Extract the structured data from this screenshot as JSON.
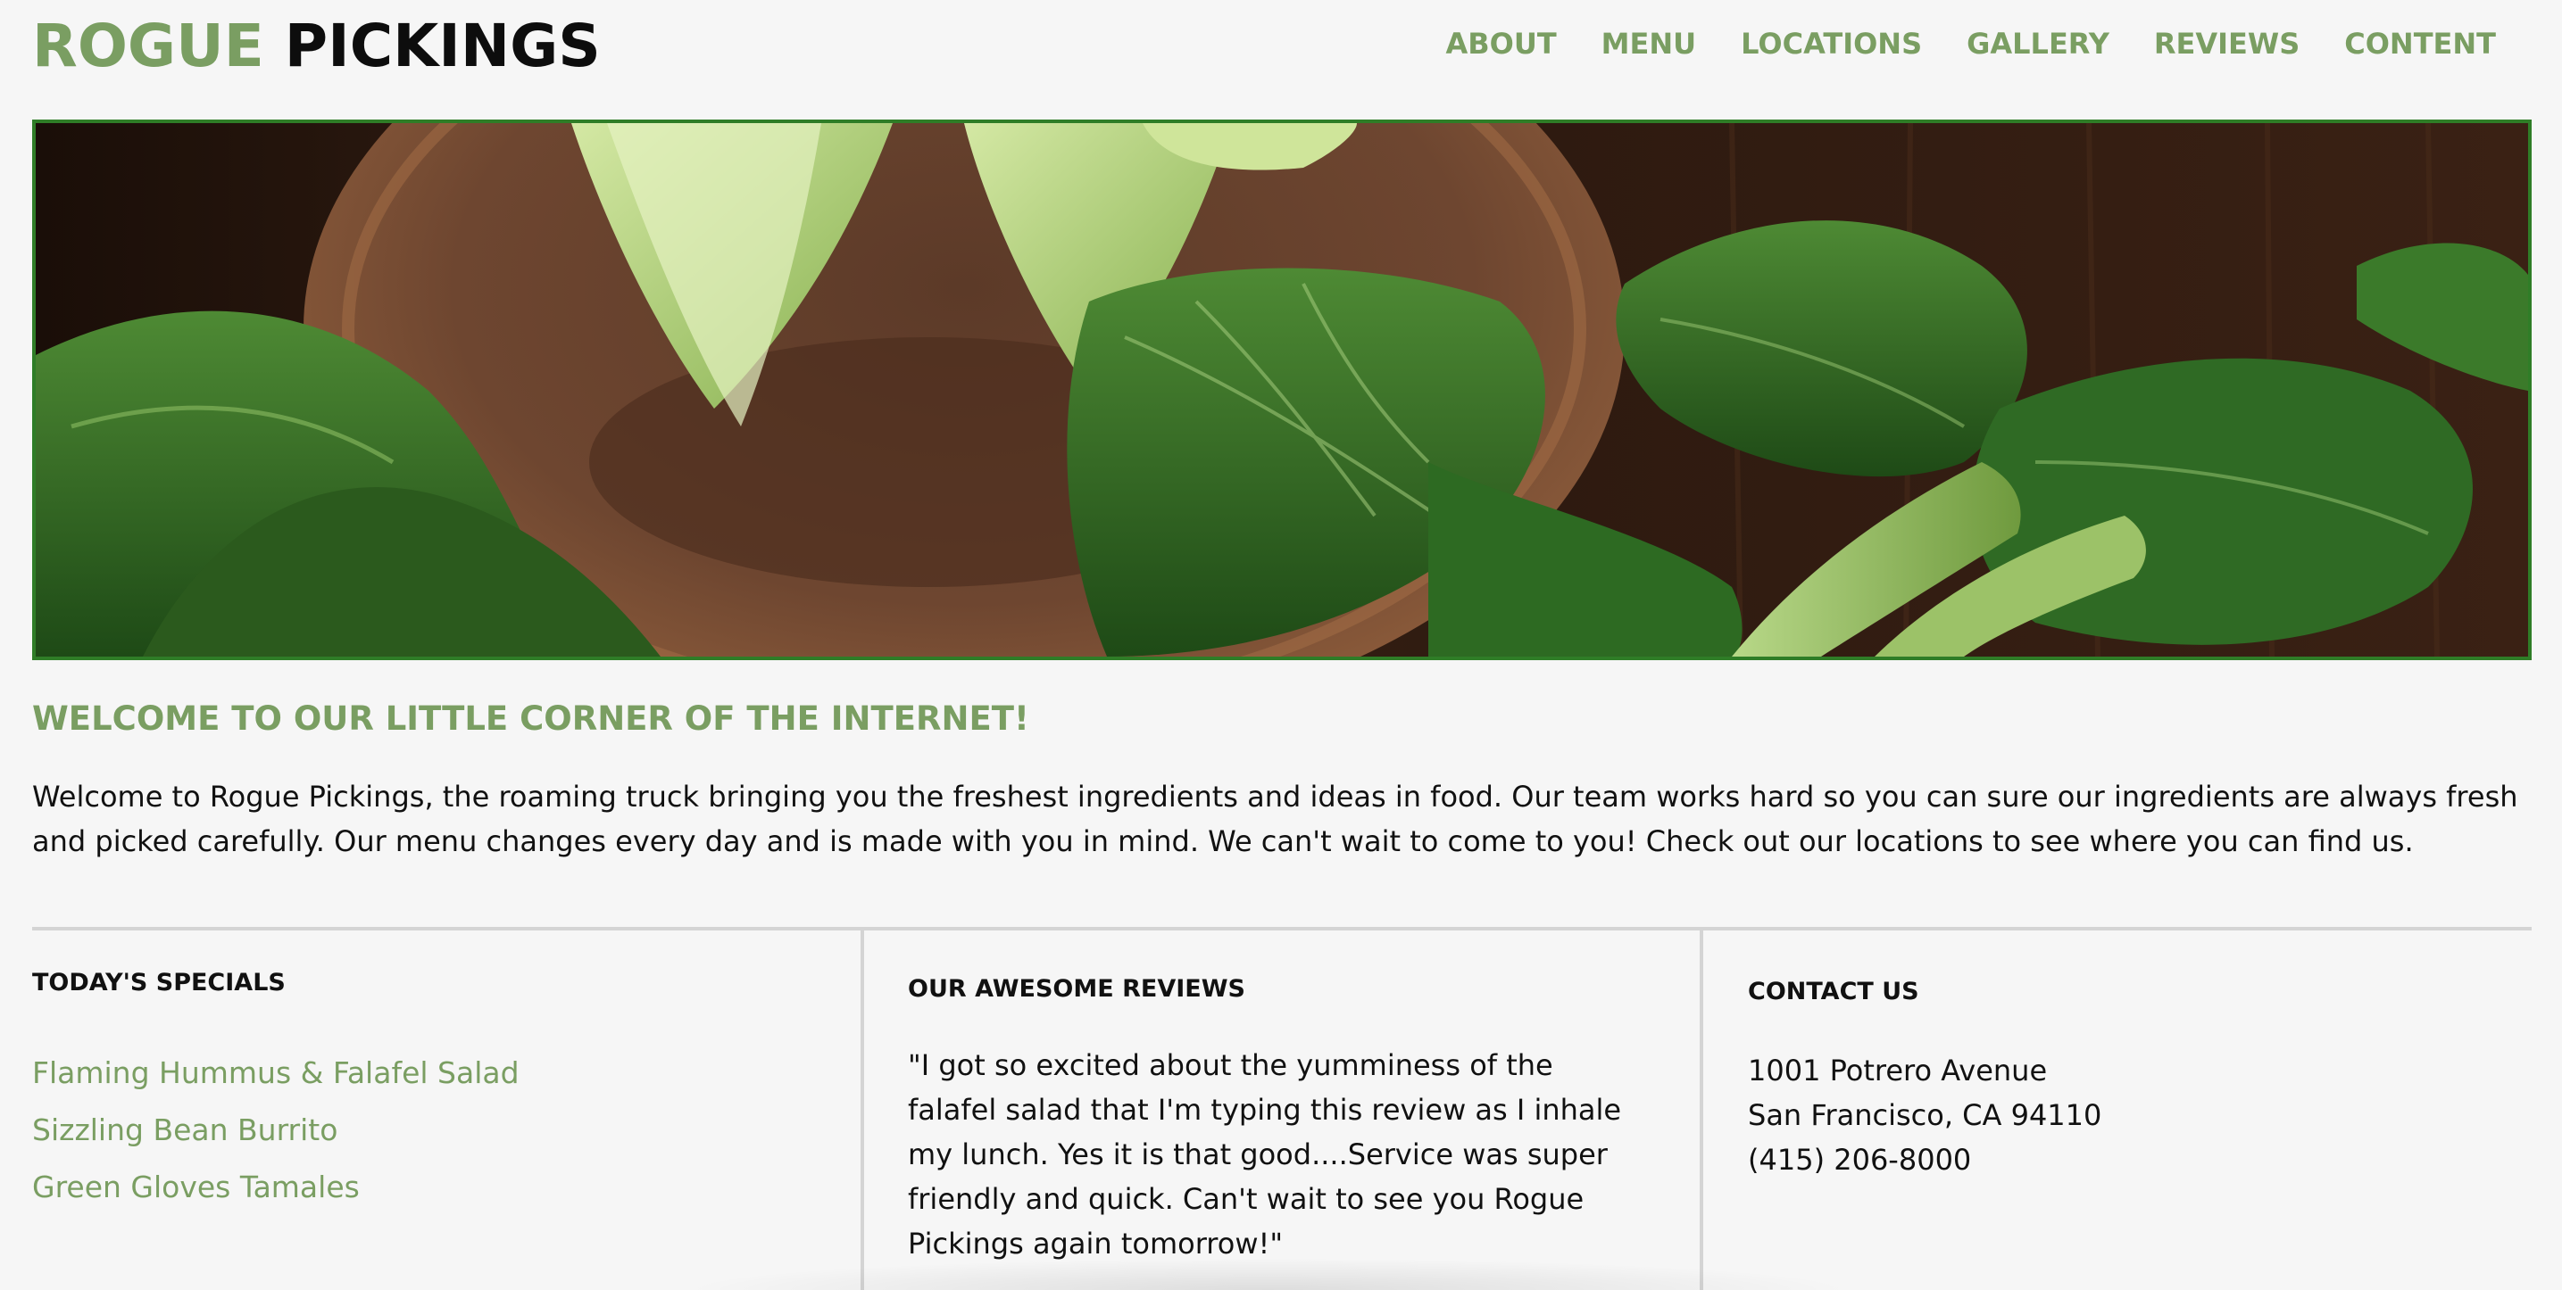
{
  "header": {
    "logo_part1": "ROGUE",
    "logo_part2": "PICKINGS",
    "nav": [
      "ABOUT",
      "MENU",
      "LOCATIONS",
      "GALLERY",
      "REVIEWS",
      "CONTENT"
    ]
  },
  "hero": {
    "alt": "bok choy on a wooden table"
  },
  "welcome": {
    "title": "WELCOME TO OUR LITTLE CORNER OF THE INTERNET!",
    "text": "Welcome to Rogue Pickings, the roaming truck bringing you the freshest ingredients and ideas in food. Our team works hard so you can sure our ingredients are always fresh and picked carefully. Our menu changes every day and is made with you in mind. We can't wait to come to you! Check out our locations to see where you can find us."
  },
  "specials": {
    "title": "TODAY'S SPECIALS",
    "items": [
      "Flaming Hummus & Falafel Salad",
      "Sizzling Bean Burrito",
      "Green Gloves Tamales"
    ]
  },
  "reviews": {
    "title": "OUR AWESOME REVIEWS",
    "text": "\"I got so excited about the yumminess of the falafel salad that I'm typing this review as I inhale my lunch. Yes it is that good....Service was super friendly and quick. Can't wait to see you Rogue Pickings again tomorrow!\""
  },
  "contact": {
    "title": "CONTACT US",
    "address1": "1001 Potrero Avenue",
    "address2": "San Francisco, CA 94110",
    "phone": "(415) 206-8000"
  },
  "colors": {
    "accent": "#7a9e62",
    "hero_border": "#2f7d27",
    "background": "#f6f6f6",
    "divider": "#d4d4d4"
  }
}
